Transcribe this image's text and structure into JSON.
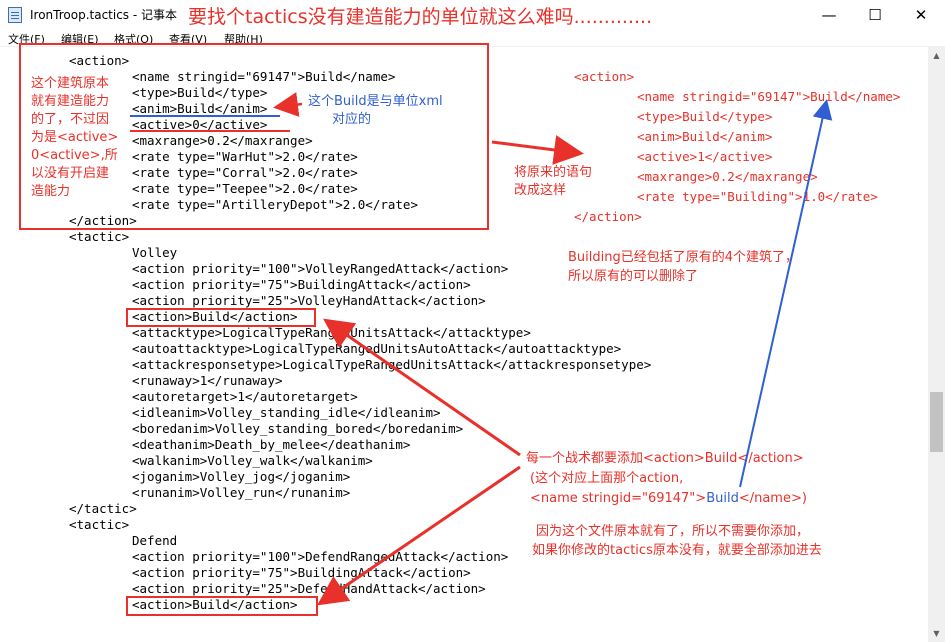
{
  "window": {
    "title": "IronTroop.tactics - 记事本",
    "title_note": "要找个tactics没有建造能力的单位就这么难吗.............",
    "minimize_glyph": "—",
    "maximize_glyph": "☐",
    "close_glyph": "✕"
  },
  "menu": [
    "文件(F)",
    "编辑(E)",
    "格式(O)",
    "查看(V)",
    "帮助(H)"
  ],
  "code_lines": [
    "<action>",
    "<name stringid=\"69147\">Build</name>",
    "<type>Build</type>",
    "<anim>Build</anim>",
    "<active>0</active>",
    "<maxrange>0.2</maxrange>",
    "<rate type=\"WarHut\">2.0</rate>",
    "<rate type=\"Corral\">2.0</rate>",
    "<rate type=\"Teepee\">2.0</rate>",
    "<rate type=\"ArtilleryDepot\">2.0</rate>",
    "</action>",
    "<tactic>",
    "Volley",
    "<action priority=\"100\">VolleyRangedAttack</action>",
    "<action priority=\"75\">BuildingAttack</action>",
    "<action priority=\"25\">VolleyHandAttack</action>",
    "<action>Build</action>",
    "<attacktype>LogicalTypeRangedUnitsAttack</attacktype>",
    "<autoattacktype>LogicalTypeRangedUnitsAutoAttack</autoattacktype>",
    "<attackresponsetype>LogicalTypeRangedUnitsAttack</attackresponsetype>",
    "<runaway>1</runaway>",
    "<autoretarget>1</autoretarget>",
    "<idleanim>Volley_standing_idle</idleanim>",
    "<boredanim>Volley_standing_bored</boredanim>",
    "<deathanim>Death_by_melee</deathanim>",
    "<walkanim>Volley_walk</walkanim>",
    "<joganim>Volley_jog</joganim>",
    "<runanim>Volley_run</runanim>",
    "</tactic>",
    "<tactic>",
    "Defend",
    "<action priority=\"100\">DefendRangedAttack</action>",
    "<action priority=\"75\">BuildingAttack</action>",
    "<action priority=\"25\">DefendHandAttack</action>",
    "<action>Build</action>"
  ],
  "annotations": {
    "left_note": [
      "这个建筑原本",
      "就有建造能力",
      "的了，不过因",
      "为是<active>",
      "0<active>,所",
      "以没有开启建",
      "造能力"
    ],
    "blue_note": [
      "这个Build是与单位xml",
      "对应的"
    ],
    "change_note": [
      "将原来的语句",
      "改成这样"
    ],
    "new_code": [
      "<action>",
      "<name stringid=\"69147\">Build</name>",
      "<type>Build</type>",
      "<anim>Build</anim>",
      "<active>1</active>",
      "<maxrange>0.2</maxrange>",
      "<rate type=\"Building\">1.0</rate>",
      "</action>"
    ],
    "building_note": [
      "Building已经包括了原有的4个建筑了，",
      "所以原有的可以删除了"
    ],
    "tactic_note_1": "每一个战术都要添加<action>Build</action>",
    "tactic_note_2": "(这个对应上面那个action,",
    "tactic_note_3a": "<name stringid=\"69147\">",
    "tactic_note_3b": "Build",
    "tactic_note_3c": "</name>)",
    "tactic_note_4": [
      "因为这个文件原本就有了，所以不需要你添加，",
      "如果你修改的tactics原本没有，就要全部添加进去"
    ]
  },
  "colors": {
    "annotation_red": "#e8312a",
    "annotation_blue": "#2f5fd0"
  }
}
